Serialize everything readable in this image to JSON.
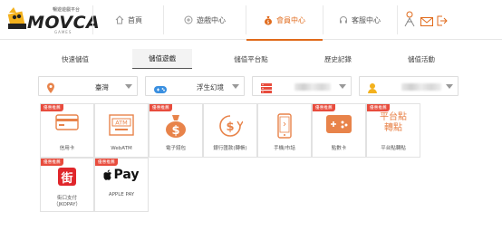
{
  "logo": {
    "brand": "MOVCA",
    "small_top": "暢遊遊戲平台",
    "small_bottom": "GAMES"
  },
  "nav": {
    "items": [
      {
        "label": "首頁",
        "icon": "home-icon"
      },
      {
        "label": "遊戲中心",
        "icon": "gamepad-icon"
      },
      {
        "label": "會員中心",
        "icon": "money-bag-icon",
        "active": true
      },
      {
        "label": "客服中心",
        "icon": "headset-icon"
      }
    ]
  },
  "tabs": [
    {
      "label": "快速儲值"
    },
    {
      "label": "儲值遊戲",
      "active": true
    },
    {
      "label": "儲值平台點"
    },
    {
      "label": "歷史記錄"
    },
    {
      "label": "儲值活動"
    }
  ],
  "filters": {
    "region": "臺灣",
    "game": "浮生幻境",
    "server": "",
    "character": ""
  },
  "ribbon_text": "優惠推薦",
  "methods": [
    {
      "name": "信用卡",
      "icon": "credit-card-icon",
      "ribbon": true
    },
    {
      "name": "WebATM",
      "icon": "atm-icon",
      "ribbon": false
    },
    {
      "name": "電子錢包",
      "icon": "money-bag-icon",
      "ribbon": true
    },
    {
      "name": "銀行匯款(轉帳)",
      "icon": "bank-transfer-icon",
      "ribbon": false
    },
    {
      "name": "手機/市話",
      "icon": "phone-icon",
      "ribbon": false
    },
    {
      "name": "點數卡",
      "icon": "game-card-icon",
      "ribbon": true
    },
    {
      "name": "平台點轉點",
      "icon": "platform-points-icon",
      "ribbon": true,
      "art_text_1": "平台點",
      "art_text_2": "轉點"
    },
    {
      "name": "街口支付（JKOPAY）",
      "icon": "jkopay-icon",
      "ribbon": true,
      "art_text_1": "街"
    },
    {
      "name": "APPLE PAY",
      "icon": "apple-pay-icon",
      "ribbon": true,
      "art_text_1": "Pay"
    }
  ],
  "colors": {
    "accent": "#e06a1b",
    "ribbon": "#e84c3d",
    "icon_orange": "#e8834a"
  }
}
